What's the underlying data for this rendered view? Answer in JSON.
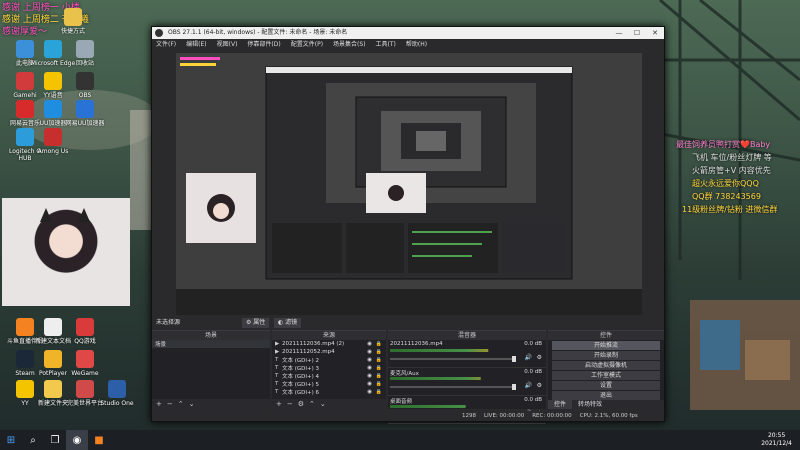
{
  "colors": {
    "accent": "#2f6fd6",
    "meter_green": "#4da34d",
    "meter_yellow": "#b5a62c",
    "meter_red": "#a33333",
    "overlay_pink": "#ff3fb0",
    "overlay_yellow": "#ffd43b"
  },
  "desktop_overlay": [
    "感谢 上周榜一 小楼",
    "感谢 上周榜二 苍穹曦",
    "感谢厚爱～"
  ],
  "desktop_icons": [
    {
      "label": "快捷方式",
      "icon": "shortcut-icon",
      "color": "#e8c24a"
    },
    {
      "label": "此电脑",
      "icon": "computer-icon",
      "color": "#3c8fd9"
    },
    {
      "label": "Microsoft Edge",
      "icon": "edge-icon",
      "color": "#2aa4d8"
    },
    {
      "label": "回收站",
      "icon": "recycle-bin-icon",
      "color": "#9aa7b4"
    },
    {
      "label": "Gamehi",
      "icon": "gamehi-icon",
      "color": "#d23b3b"
    },
    {
      "label": "YY语音",
      "icon": "yy-icon",
      "color": "#f5c400"
    },
    {
      "label": "OBS",
      "icon": "obs-icon",
      "color": "#333333"
    },
    {
      "label": "网易云音乐",
      "icon": "netease-music-icon",
      "color": "#d72b2b"
    },
    {
      "label": "UU加速器",
      "icon": "uu-icon",
      "color": "#1f8de0"
    },
    {
      "label": "网易UU加速器",
      "icon": "uu2-icon",
      "color": "#2a73d6"
    },
    {
      "label": "Logitech G HUB",
      "icon": "ghub-icon",
      "color": "#2d9cdb"
    },
    {
      "label": "Among Us",
      "icon": "among-us-icon",
      "color": "#c72f2f"
    },
    {
      "label": "斗鱼直播伴侣",
      "icon": "douyu-icon",
      "color": "#f58220"
    },
    {
      "label": "新建文本文档",
      "icon": "text-doc-icon",
      "color": "#eeeeee"
    },
    {
      "label": "QQ游戏",
      "icon": "qq-game-icon",
      "color": "#d93a3a"
    },
    {
      "label": "Steam",
      "icon": "steam-icon",
      "color": "#1b2838"
    },
    {
      "label": "PotPlayer",
      "icon": "potplayer-icon",
      "color": "#f0b429"
    },
    {
      "label": "WeGame",
      "icon": "wegame-icon",
      "color": "#e04848"
    },
    {
      "label": "YY",
      "icon": "yy2-icon",
      "color": "#f5c400"
    },
    {
      "label": "新建文件夹",
      "icon": "folder-icon",
      "color": "#f2c94c"
    },
    {
      "label": "完美世界平台",
      "icon": "perfect-world-icon",
      "color": "#d14a4a"
    },
    {
      "label": "Studio One",
      "icon": "studio-one-icon",
      "color": "#2c5fa8"
    }
  ],
  "right_overlay": {
    "title": "最佳饲养员鸭打赏❤️Baby",
    "lines": [
      "飞机 车位/粉丝灯牌 等",
      "火箭房管+V 内容优先",
      "超火永远爱你QQQ",
      "QQ群 738243569",
      "11级粉丝牌/钻粉 进微信群"
    ]
  },
  "obs": {
    "title": "OBS 27.1.1 (64-bit, windows) - 配置文件: 未命名 - 场景: 未命名",
    "menu": [
      "文件(F)",
      "编辑(E)",
      "视图(V)",
      "停靠部件(D)",
      "配置文件(P)",
      "场景集合(S)",
      "工具(T)",
      "帮助(H)"
    ],
    "preview_label": "未选择源",
    "preview_buttons": [
      "属性",
      "滤镜"
    ],
    "scenes": {
      "header": "场景",
      "items": [
        "场景"
      ]
    },
    "sources": {
      "header": "来源",
      "items": [
        {
          "name": "20211112036.mp4 (2)",
          "type": "play"
        },
        {
          "name": "20211112052.mp4",
          "type": "play"
        },
        {
          "name": "文本 (GDI+) 2",
          "type": "text"
        },
        {
          "name": "文本 (GDI+) 3",
          "type": "text"
        },
        {
          "name": "文本 (GDI+) 4",
          "type": "text"
        },
        {
          "name": "文本 (GDI+) 5",
          "type": "text"
        },
        {
          "name": "文本 (GDI+) 6",
          "type": "text"
        }
      ]
    },
    "mixer": {
      "header": "混音器",
      "channels": [
        {
          "name": "20211112036.mp4",
          "db": "0.0 dB",
          "level": 0.78
        },
        {
          "name": "麦克风/Aux",
          "db": "0.0 dB",
          "level": 0.72
        },
        {
          "name": "桌面音频",
          "db": "0.0 dB",
          "level": 0.6
        }
      ]
    },
    "controls": {
      "header": "控件",
      "buttons": [
        "开始推流",
        "开始录制",
        "启动虚拟摄像机",
        "工作室模式",
        "设置",
        "退出"
      ]
    },
    "bottom_tabs": [
      "控件",
      "转场特效"
    ],
    "status": {
      "live": "LIVE: 00:00:00",
      "rec": "REC: 00:00:00",
      "cpu": "CPU: 2.1%, 60.00 fps",
      "dropped": "1298"
    }
  },
  "clock": {
    "time": "20:55",
    "date": "2021/12/4"
  }
}
